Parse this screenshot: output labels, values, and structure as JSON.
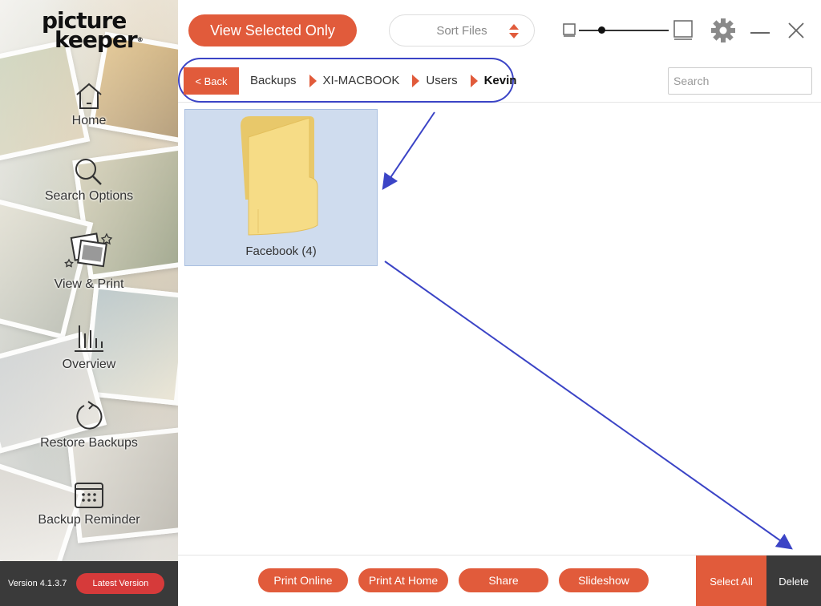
{
  "brand": {
    "line1": "picture",
    "line2": "keeper",
    "registered": "®"
  },
  "sidebar": {
    "items": [
      {
        "label": "Home",
        "icon": "home-icon"
      },
      {
        "label": "Search Options",
        "icon": "search-icon"
      },
      {
        "label": "View & Print",
        "icon": "photos-icon"
      },
      {
        "label": "Overview",
        "icon": "bar-chart-icon"
      },
      {
        "label": "Restore Backups",
        "icon": "restore-icon"
      },
      {
        "label": "Backup Reminder",
        "icon": "calendar-icon"
      }
    ],
    "version": "Version 4.1.3.7",
    "latest_button": "Latest Version"
  },
  "toolbar": {
    "view_selected": "View Selected Only",
    "sort_files": "Sort Files"
  },
  "breadcrumb": {
    "back": "< Back",
    "items": [
      "Backups",
      "XI-MACBOOK",
      "Users",
      "Kevin"
    ]
  },
  "search": {
    "placeholder": "Search",
    "value": ""
  },
  "folders": [
    {
      "name": "Facebook (4)",
      "selected": true
    }
  ],
  "bottom": {
    "print_online": "Print Online",
    "print_at_home": "Print At Home",
    "share": "Share",
    "slideshow": "Slideshow",
    "select_all": "Select All",
    "delete": "Delete"
  },
  "colors": {
    "accent": "#e15b3b",
    "dark": "#3a3a3a",
    "annotation": "#3b44c6",
    "selection": "#cfdcee"
  }
}
